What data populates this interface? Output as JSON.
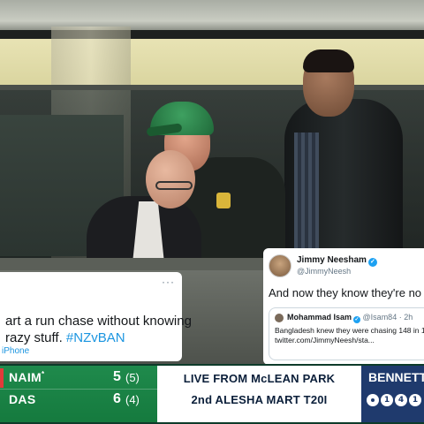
{
  "tweet_left": {
    "more": "···",
    "text_main": "art a run chase without knowing",
    "text_second": "razy stuff. ",
    "hashtag": "#NZvBAN",
    "source": "iPhone"
  },
  "tweet_right": {
    "name": "Jimmy Neesham",
    "verified": "✓",
    "handle": "@JimmyNeesh",
    "text": "And now they know they're no",
    "quote": {
      "name": "Mohammad Isam",
      "verified": "✓",
      "meta": "@Isam84 · 2h",
      "line1": "Bangladesh knew they were chasing 148 in 1",
      "line2": "twitter.com/JimmyNeesh/sta..."
    }
  },
  "scorebar": {
    "batters": [
      {
        "name": "NAIM",
        "star": "*",
        "runs": "5",
        "balls": "(5)",
        "on_strike": true
      },
      {
        "name": "DAS",
        "star": "",
        "runs": "6",
        "balls": "(4)",
        "on_strike": false
      }
    ],
    "center_line1": "LIVE FROM McLEAN PARK",
    "center_line2": "2nd ALESHA MART T20I",
    "bowler": "BENNETT",
    "over_balls": [
      "•",
      "1",
      "4",
      "1"
    ],
    "colors": {
      "batting_bg": "#1f8a4c",
      "bowling_bg": "#1f3a6d",
      "strike_marker": "#e23a3a"
    }
  }
}
